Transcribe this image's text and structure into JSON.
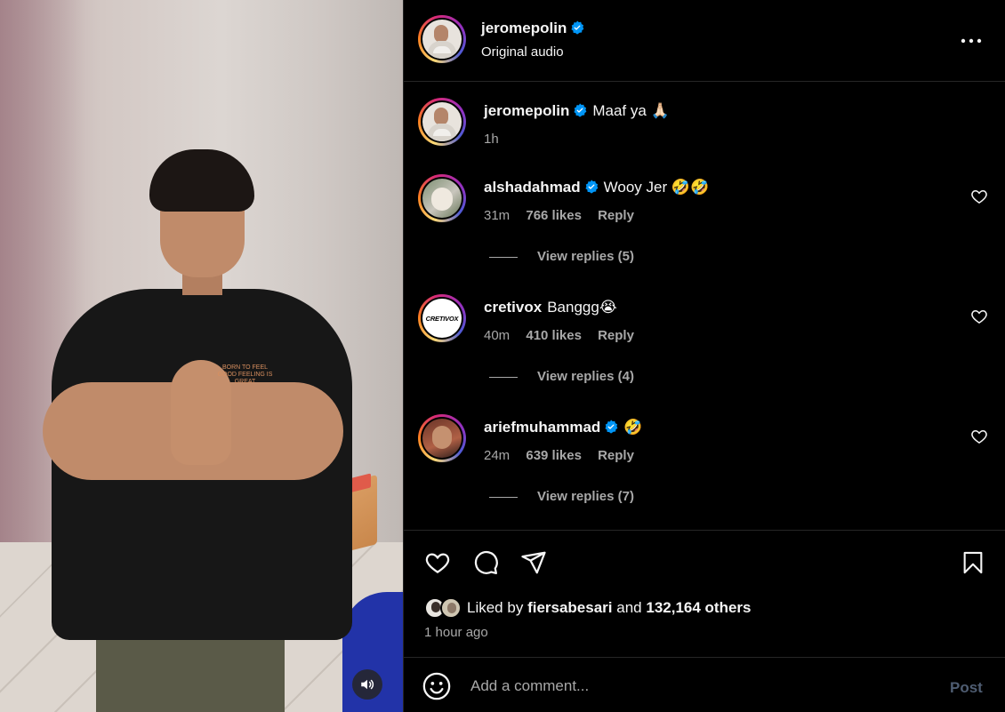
{
  "post": {
    "username": "jeromepolin",
    "audio": "Original audio",
    "caption": "Maaf ya 🙏🏻",
    "caption_time": "1h"
  },
  "comments": [
    {
      "username": "alshadahmad",
      "verified": true,
      "text": "Wooy Jer 🤣🤣",
      "time": "31m",
      "likes": "766 likes",
      "reply": "Reply",
      "replies": "View replies (5)"
    },
    {
      "username": "cretivox",
      "verified": false,
      "text": "Banggg😭",
      "time": "40m",
      "likes": "410 likes",
      "reply": "Reply",
      "replies": "View replies (4)",
      "avatar_text": "CRETIVOX"
    },
    {
      "username": "ariefmuhammad",
      "verified": true,
      "text": "🤣",
      "time": "24m",
      "likes": "639 likes",
      "reply": "Reply",
      "replies": "View replies (7)"
    }
  ],
  "likes": {
    "prefix": "Liked by",
    "user": "fiersabesari",
    "and": "and",
    "others": "132,164 others",
    "time_ago": "1 hour ago"
  },
  "composer": {
    "placeholder": "Add a comment...",
    "post_label": "Post"
  },
  "media": {
    "shirt_print": "BORN TO FEEL GOOD FEELING IS GREAT"
  },
  "colors": {
    "background": "#000000",
    "verified": "#0095f6",
    "muted_text": "#a8a8a8",
    "post_button_disabled": "#4f5d72"
  },
  "icons": [
    "more-options-icon",
    "verified-badge-icon",
    "heart-icon",
    "comment-icon",
    "share-icon",
    "bookmark-icon",
    "emoji-icon",
    "speaker-icon"
  ]
}
